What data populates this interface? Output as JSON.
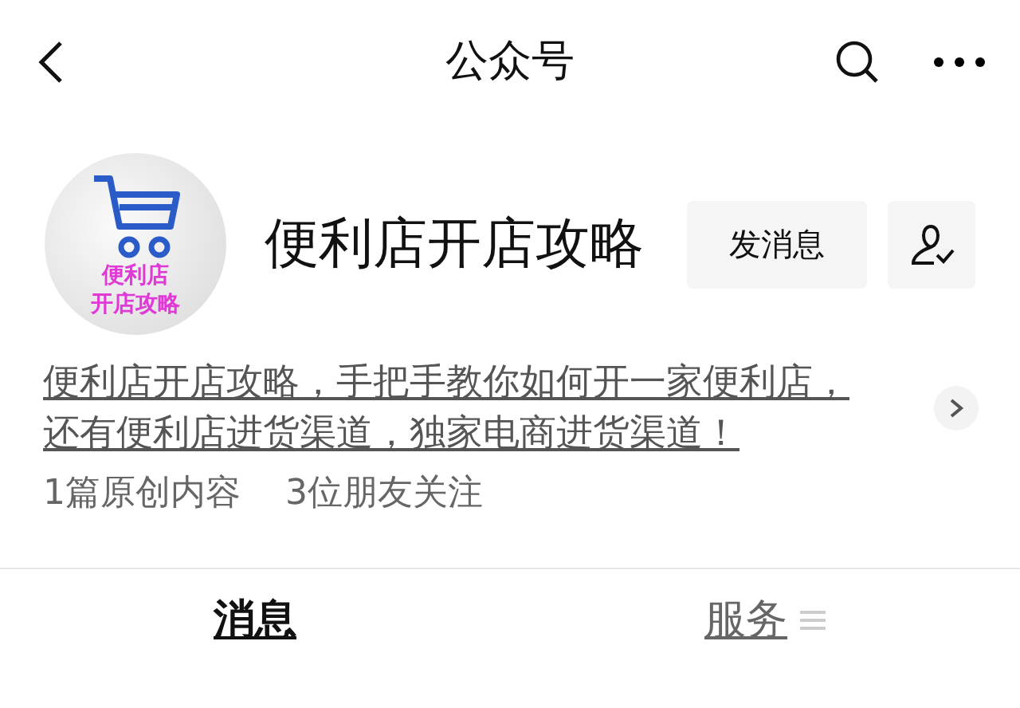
{
  "header": {
    "title": "公众号"
  },
  "account": {
    "avatar_lines": [
      "便利店",
      "开店攻略"
    ],
    "name": "便利店开店攻略",
    "message_button": "发消息"
  },
  "description_lines": [
    "便利店开店攻略，手把手教你如何开一家便利店，",
    "还有便利店进货渠道，独家电商进货渠道！"
  ],
  "stats": [
    "1篇原创内容",
    "3位朋友关注"
  ],
  "tabs": [
    {
      "label": "消息",
      "selected": true,
      "kind": "plain"
    },
    {
      "label": "服务",
      "selected": false,
      "kind": "menu"
    }
  ]
}
